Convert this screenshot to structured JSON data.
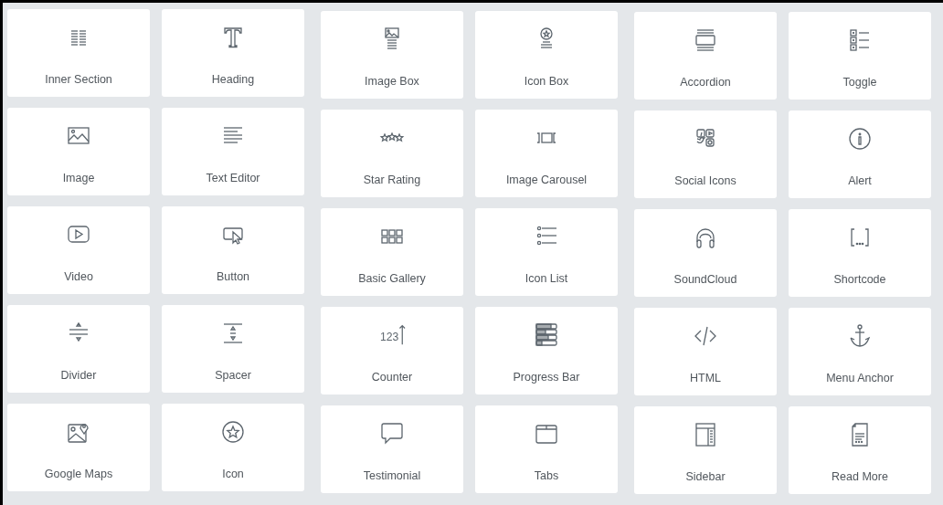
{
  "widgets": [
    {
      "label": "Inner Section"
    },
    {
      "label": "Heading"
    },
    {
      "label": "Image Box"
    },
    {
      "label": "Icon Box"
    },
    {
      "label": "Accordion"
    },
    {
      "label": "Toggle"
    },
    {
      "label": "Image"
    },
    {
      "label": "Text Editor"
    },
    {
      "label": "Star Rating"
    },
    {
      "label": "Image Carousel"
    },
    {
      "label": "Social Icons"
    },
    {
      "label": "Alert"
    },
    {
      "label": "Video"
    },
    {
      "label": "Button"
    },
    {
      "label": "Basic Gallery"
    },
    {
      "label": "Icon List"
    },
    {
      "label": "SoundCloud"
    },
    {
      "label": "Shortcode"
    },
    {
      "label": "Divider"
    },
    {
      "label": "Spacer"
    },
    {
      "label": "Counter",
      "icon_text": "123"
    },
    {
      "label": "Progress Bar"
    },
    {
      "label": "HTML"
    },
    {
      "label": "Menu Anchor"
    },
    {
      "label": "Google Maps"
    },
    {
      "label": "Icon"
    },
    {
      "label": "Testimonial"
    },
    {
      "label": "Tabs"
    },
    {
      "label": "Sidebar"
    },
    {
      "label": "Read More"
    }
  ]
}
